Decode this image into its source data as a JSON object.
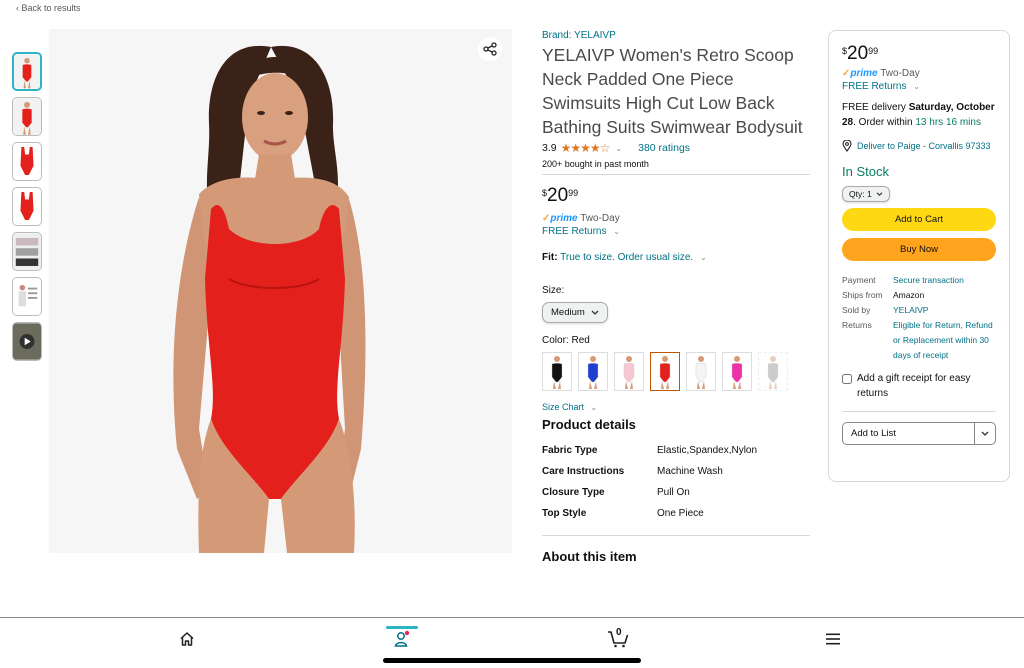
{
  "nav": {
    "back_label": "Back to results"
  },
  "thumbnails": [
    {
      "kind": "front",
      "color": "#e3201b"
    },
    {
      "kind": "back",
      "color": "#e3201b"
    },
    {
      "kind": "flat",
      "color": "#e3201b"
    },
    {
      "kind": "flat",
      "color": "#e3201b"
    },
    {
      "kind": "collage",
      "color": "#999999"
    },
    {
      "kind": "chart",
      "color": "#bbbbbb"
    },
    {
      "kind": "video",
      "color": "#555555"
    }
  ],
  "product": {
    "brand": "Brand: YELAIVP",
    "title": "YELAIVP Women's Retro Scoop Neck Padded One Piece Swimsuits High Cut Low Back Bathing Suits Swimwear Bodysuit",
    "rating_value": "3.9",
    "stars_fraction": 0.78,
    "ratings_count": "380 ratings",
    "bought": "200+ bought in past month",
    "price_symbol": "$",
    "price_whole": "20",
    "price_fraction": "99",
    "prime_label": "prime",
    "prime_suffix": "Two-Day",
    "free_returns": "FREE Returns",
    "fit_label": "Fit:",
    "fit_value": "True to size. Order usual size.",
    "size_label": "Size:",
    "size_selected": "Medium",
    "color_label": "Color:",
    "color_selected": "Red",
    "swatches": [
      {
        "color": "#111111"
      },
      {
        "color": "#1f3fd1"
      },
      {
        "color": "#f6c6d2"
      },
      {
        "color": "#e3201b",
        "selected": true
      },
      {
        "color": "#f4f4f4"
      },
      {
        "color": "#f030a8"
      },
      {
        "color": "#9a9a9a",
        "unavailable": true
      }
    ],
    "size_chart": "Size Chart",
    "details_title": "Product details",
    "details": [
      {
        "k": "Fabric Type",
        "v": "Elastic,Spandex,Nylon"
      },
      {
        "k": "Care Instructions",
        "v": "Machine Wash"
      },
      {
        "k": "Closure Type",
        "v": "Pull On"
      },
      {
        "k": "Top Style",
        "v": "One Piece"
      }
    ],
    "about_title": "About this item"
  },
  "buybox": {
    "price_symbol": "$",
    "price_whole": "20",
    "price_fraction": "99",
    "prime_label": "prime",
    "prime_suffix": "Two-Day",
    "free_returns": "FREE Returns",
    "delivery_prefix": "FREE delivery",
    "delivery_date": "Saturday, October 28",
    "delivery_mid": ". Order within",
    "delivery_time": "13 hrs 16 mins",
    "deliver_to": "Deliver to Paige - Corvallis 97333",
    "stock": "In Stock",
    "qty_label": "Qty: 1",
    "add_to_cart": "Add to Cart",
    "buy_now": "Buy Now",
    "info": [
      {
        "k": "Payment",
        "v": "Secure transaction",
        "link": true
      },
      {
        "k": "Ships from",
        "v": "Amazon",
        "link": false
      },
      {
        "k": "Sold by",
        "v": "YELAIVP",
        "link": true
      },
      {
        "k": "Returns",
        "v": "Eligible for Return, Refund or Replacement within 30 days of receipt",
        "link": true
      }
    ],
    "gift_label": "Add a gift receipt for easy returns",
    "add_to_list": "Add to List"
  },
  "bottom_nav": {
    "items": [
      "home-icon",
      "account-icon",
      "cart-icon",
      "menu-icon"
    ],
    "cart_count": "0",
    "active": "account-icon",
    "accent": "#2bb3c8"
  }
}
